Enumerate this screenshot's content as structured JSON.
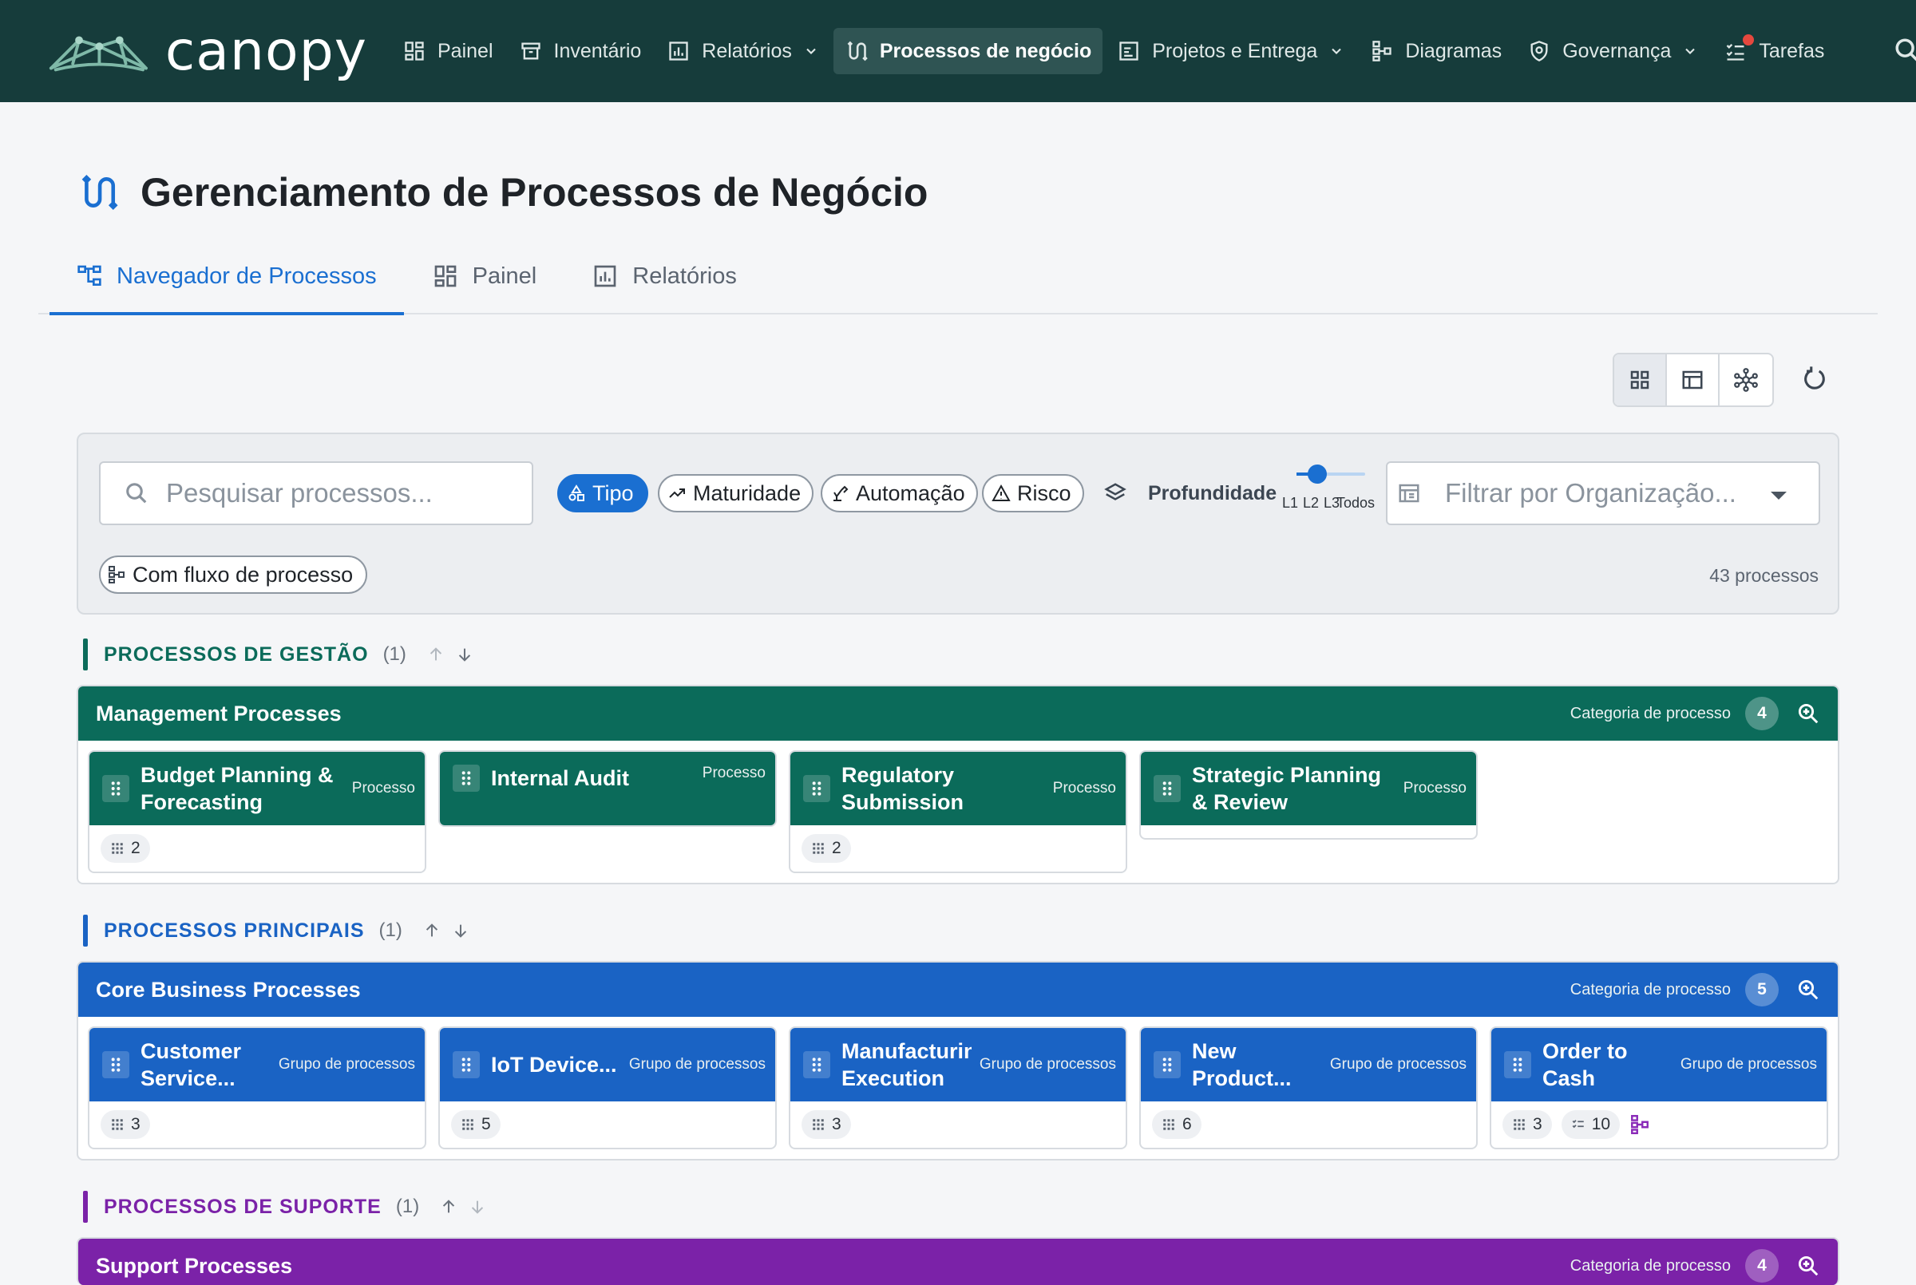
{
  "app": {
    "brand": "canopy",
    "nav": [
      {
        "label": "Painel",
        "icon": "dashboard-icon"
      },
      {
        "label": "Inventário",
        "icon": "archive-icon"
      },
      {
        "label": "Relatórios",
        "icon": "report-icon",
        "dropdown": true
      },
      {
        "label": "Processos de negócio",
        "icon": "process-icon",
        "active": true
      },
      {
        "label": "Projetos e Entrega",
        "icon": "project-icon",
        "dropdown": true
      },
      {
        "label": "Diagramas",
        "icon": "diagram-icon"
      },
      {
        "label": "Governança",
        "icon": "shield-icon",
        "dropdown": true
      },
      {
        "label": "Tarefas",
        "icon": "tasks-icon",
        "notification": true
      }
    ]
  },
  "page": {
    "title": "Gerenciamento de Processos de Negócio",
    "tabs": [
      {
        "label": "Navegador de Processos",
        "active": true
      },
      {
        "label": "Painel"
      },
      {
        "label": "Relatórios"
      }
    ]
  },
  "filters": {
    "search_placeholder": "Pesquisar processos...",
    "chips": [
      "Tipo",
      "Maturidade",
      "Automação",
      "Risco"
    ],
    "selected_chip": "Tipo",
    "depth_label": "Profundidade",
    "depth_marks": [
      "L1",
      "L2",
      "L3",
      "Todos"
    ],
    "depth_value": "L1",
    "org_placeholder": "Filtrar por Organização...",
    "flow_chip": "Com fluxo de processo",
    "process_count": "43 processos"
  },
  "sections": [
    {
      "name": "PROCESSOS DE GESTÃO",
      "count": "(1)",
      "color": "#0b6b5a",
      "category": {
        "title": "Management Processes",
        "type": "Categoria de processo",
        "badge": "4",
        "tiles": [
          {
            "name": "Budget Planning & Forecasting",
            "type": "Processo",
            "children": "2"
          },
          {
            "name": "Internal Audit",
            "type": "Processo"
          },
          {
            "name": "Regulatory Submission",
            "type": "Processo",
            "children": "2"
          },
          {
            "name": "Strategic Planning & Review",
            "type": "Processo"
          }
        ]
      }
    },
    {
      "name": "PROCESSOS PRINCIPAIS",
      "count": "(1)",
      "color": "#1a63c4",
      "category": {
        "title": "Core Business Processes",
        "type": "Categoria de processo",
        "badge": "5",
        "tiles": [
          {
            "name": "Customer Service...",
            "type": "Grupo de processos",
            "children": "3"
          },
          {
            "name": "IoT Device...",
            "type": "Grupo de processos",
            "children": "5"
          },
          {
            "name": "Manufacturing Execution",
            "type": "Grupo de processos",
            "children": "3"
          },
          {
            "name": "New Product...",
            "type": "Grupo de processos",
            "children": "6"
          },
          {
            "name": "Order to Cash",
            "type": "Grupo de processos",
            "children": "3",
            "tasks": "10",
            "has_flow": true
          }
        ]
      }
    },
    {
      "name": "PROCESSOS DE SUPORTE",
      "count": "(1)",
      "color": "#7b22a8",
      "category": {
        "title": "Support Processes",
        "type": "Categoria de processo",
        "badge": "4"
      }
    }
  ]
}
